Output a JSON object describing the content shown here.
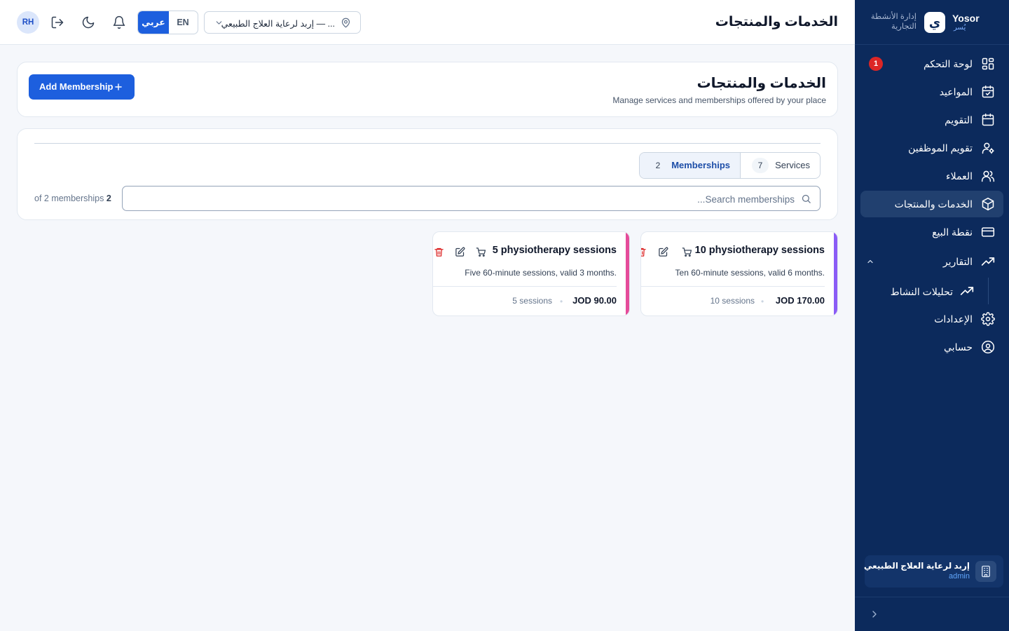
{
  "brand": {
    "name": "Yosor",
    "sub": "يُسر",
    "logo": "ي",
    "tagline": "إدارة الأنشطة التجارية"
  },
  "topbar": {
    "title": "الخدمات والمنتجات",
    "avatar": "RH",
    "lang_en": "EN",
    "lang_ar": "عربي",
    "location": "إربد لرعاية العلاج الطبيعي — ..."
  },
  "sidebar": {
    "items": [
      {
        "label": "لوحة التحكم",
        "icon": "dashboard-grid-icon",
        "badge": "1"
      },
      {
        "label": "المواعيد",
        "icon": "calendar-check-icon"
      },
      {
        "label": "التقويم",
        "icon": "calendar-icon"
      },
      {
        "label": "تقويم الموظفين",
        "icon": "user-cog-icon"
      },
      {
        "label": "العملاء",
        "icon": "users-icon"
      },
      {
        "label": "الخدمات والمنتجات",
        "icon": "package-icon",
        "active": true
      },
      {
        "label": "نقطة البيع",
        "icon": "credit-card-icon"
      },
      {
        "label": "التقارير",
        "icon": "trending-up-icon",
        "expanded": true
      },
      {
        "label": "الإعدادات",
        "icon": "settings-gear-icon"
      },
      {
        "label": "حسابي",
        "icon": "user-circle-icon"
      }
    ],
    "sub_items": [
      {
        "label": "تحليلات النشاط",
        "icon": "trending-up-icon"
      }
    ],
    "place": {
      "name": "إربد لرعاية العلاج الطبيعي",
      "role": "admin"
    }
  },
  "header": {
    "title": "الخدمات والمنتجات",
    "subtitle": "Manage services and memberships offered by your place",
    "add_button": "Add Membership"
  },
  "filters": {
    "tabs": [
      {
        "label": "Services",
        "count": "7"
      },
      {
        "label": "Memberships",
        "count": "2",
        "active": true
      }
    ],
    "search_placeholder": "Search memberships...",
    "count_number": "2",
    "count_suffix": "of 2 memberships"
  },
  "memberships": [
    {
      "title": "10 physiotherapy sessions",
      "description": "Ten 60-minute sessions, valid 6 months.",
      "price": "JOD 170.00",
      "sessions": "10 sessions",
      "accent": "#8b5cf6"
    },
    {
      "title": "5 physiotherapy sessions",
      "description": "Five 60-minute sessions, valid 3 months.",
      "price": "JOD 90.00",
      "sessions": "5 sessions",
      "accent": "#e54c9a"
    }
  ],
  "colors": {
    "sidebar_bg": "#0c2a5c",
    "primary": "#1d5fde",
    "danger": "#dc2626"
  }
}
